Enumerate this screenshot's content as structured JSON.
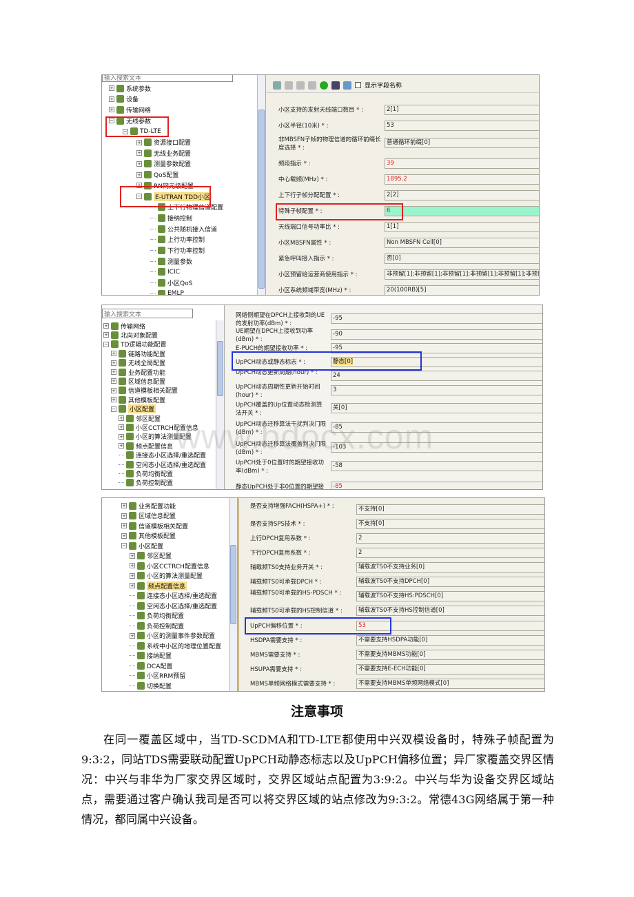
{
  "shot1": {
    "search_placeholder": "输入搜索文本",
    "show_field_name": "显示字段名称",
    "tree": [
      {
        "label": "系统参数",
        "level": 0,
        "exp": "+"
      },
      {
        "label": "设备",
        "level": 0,
        "exp": "+"
      },
      {
        "label": "传输网络",
        "level": 0,
        "exp": "+"
      },
      {
        "label": "无线参数",
        "level": 0,
        "exp": "-"
      },
      {
        "label": "TD-LTE",
        "level": 1,
        "exp": "-"
      },
      {
        "label": "资源接口配置",
        "level": 2,
        "exp": "+"
      },
      {
        "label": "无线业务配置",
        "level": 2,
        "exp": "+"
      },
      {
        "label": "测量参数配置",
        "level": 2,
        "exp": "+"
      },
      {
        "label": "QoS配置",
        "level": 2,
        "exp": "+"
      },
      {
        "label": "RN网元级配置",
        "level": 2,
        "exp": "+"
      },
      {
        "label": "E-UTRAN TDD小区",
        "level": 2,
        "exp": "-",
        "selected": true
      },
      {
        "label": "上下行物理信道配置",
        "level": 3
      },
      {
        "label": "接纳控制",
        "level": 3
      },
      {
        "label": "公共随机接入信道",
        "level": 3
      },
      {
        "label": "上行功率控制",
        "level": 3
      },
      {
        "label": "下行功率控制",
        "level": 3
      },
      {
        "label": "测量参数",
        "level": 3
      },
      {
        "label": "ICIC",
        "level": 3
      },
      {
        "label": "小区QoS",
        "level": 3
      },
      {
        "label": "EMLP",
        "level": 3
      }
    ],
    "fields": [
      {
        "label": "小区支持的发射天线端口数目 * :",
        "value": "2[1]"
      },
      {
        "label": "小区半径(10米) * :",
        "value": "53"
      },
      {
        "label": "非MBSFN子帧的物理信道的循环前缀长度选择 * :",
        "value": "普通循环前缀[0]"
      },
      {
        "label": "频段指示 * :",
        "value": "39",
        "red": true
      },
      {
        "label": "中心载频(MHz) * :",
        "value": "1895.2",
        "red": true
      },
      {
        "label": "上下行子帧分配配置 * :",
        "value": "2[2]"
      },
      {
        "label": "特殊子帧配置 * :",
        "value": "6",
        "red": true,
        "highlight": "#98f5cc"
      },
      {
        "label": "天线端口信号功率比 * :",
        "value": "1[1]"
      },
      {
        "label": "小区MBSFN属性 * :",
        "value": "Non MBSFN Cell[0]"
      },
      {
        "label": "紧急呼叫接入指示 * :",
        "value": "否[0]"
      },
      {
        "label": "小区预留给运营商使用指示 * :",
        "value": "非预留[1];非预留[1];非预留[1];非预留[1];非预留[1];非预留[1]"
      },
      {
        "label": "小区系统频域带宽(MHz) * :",
        "value": "20(100RB)[5]"
      }
    ]
  },
  "shot2": {
    "search_placeholder": "输入搜索文本",
    "tree": [
      {
        "label": "传输网络",
        "level": 0,
        "exp": "+"
      },
      {
        "label": "北向对象配置",
        "level": 0,
        "exp": "+"
      },
      {
        "label": "TD逻辑功能配置",
        "level": 0,
        "exp": "-"
      },
      {
        "label": "链路功能配置",
        "level": 1,
        "exp": "+"
      },
      {
        "label": "无线全局配置",
        "level": 1,
        "exp": "+"
      },
      {
        "label": "业务配置功能",
        "level": 1,
        "exp": "+"
      },
      {
        "label": "区域信息配置",
        "level": 1,
        "exp": "+"
      },
      {
        "label": "信道模板相关配置",
        "level": 1,
        "exp": "+"
      },
      {
        "label": "其他模板配置",
        "level": 1,
        "exp": "+"
      },
      {
        "label": "小区配置",
        "level": 1,
        "exp": "-",
        "selected": true
      },
      {
        "label": "邻区配置",
        "level": 2,
        "exp": "+"
      },
      {
        "label": "小区CCTRCH配置信息",
        "level": 2,
        "exp": "+"
      },
      {
        "label": "小区的算法测量配置",
        "level": 2,
        "exp": "+"
      },
      {
        "label": "频点配置信息",
        "level": 2,
        "exp": "+"
      },
      {
        "label": "连接态小区选择/重选配置",
        "level": 2
      },
      {
        "label": "空闲态小区选择/重选配置",
        "level": 2
      },
      {
        "label": "负荷均衡配置",
        "level": 2
      },
      {
        "label": "负荷控制配置",
        "level": 2
      }
    ],
    "fields": [
      {
        "label": "网络侧期望在DPCH上接收到的UE的发射功率(dBm) * :",
        "value": "-95"
      },
      {
        "label": "UE期望在DPCH上接收到功率(dBm) * :",
        "value": "-90"
      },
      {
        "label": "E-PUCH的期望接收功率 * :",
        "value": "-95"
      },
      {
        "label": "UpPCH动态或静态标志 * :",
        "value": "静态[0]",
        "sel": true
      },
      {
        "label": "UpPCH动态更新周期(hour) * :",
        "value": "24"
      },
      {
        "label": "UpPCH动态周期性更新开始时间(hour) * :",
        "value": "3"
      },
      {
        "label": "UpPCH覆盖的Up位置动态检测算法开关 * :",
        "value": "关[0]"
      },
      {
        "label": "UpPCH动态迁移算法干扰判决门限(dBm) * :",
        "value": "-85"
      },
      {
        "label": "UpPCH动态迁移算法覆盖判决门限(dBm) * :",
        "value": "-103"
      },
      {
        "label": "UpPCH处于0位置时的期望接收功率(dBm) * :",
        "value": "-58"
      },
      {
        "label": "静态UpPCH处于非0位置的期望接收",
        "value": "-85",
        "red": true
      }
    ]
  },
  "shot3": {
    "tree": [
      {
        "label": "业务配置功能",
        "level": 0,
        "exp": "+"
      },
      {
        "label": "区域信息配置",
        "level": 0,
        "exp": "+"
      },
      {
        "label": "信道模板相关配置",
        "level": 0,
        "exp": "+"
      },
      {
        "label": "其他模板配置",
        "level": 0,
        "exp": "+"
      },
      {
        "label": "小区配置",
        "level": 0,
        "exp": "-"
      },
      {
        "label": "邻区配置",
        "level": 1,
        "exp": "+"
      },
      {
        "label": "小区CCTRCH配置信息",
        "level": 1,
        "exp": "+"
      },
      {
        "label": "小区的算法测量配置",
        "level": 1,
        "exp": "+"
      },
      {
        "label": "频点配置信息",
        "level": 1,
        "exp": "+",
        "selected": true
      },
      {
        "label": "连接态小区选择/重选配置",
        "level": 1
      },
      {
        "label": "空闲态小区选择/重选配置",
        "level": 1
      },
      {
        "label": "负荷均衡配置",
        "level": 1
      },
      {
        "label": "负荷控制配置",
        "level": 1
      },
      {
        "label": "小区的测量事件参数配置",
        "level": 1,
        "exp": "+"
      },
      {
        "label": "系统中小区的地理位置配置",
        "level": 1
      },
      {
        "label": "接纳配置",
        "level": 1
      },
      {
        "label": "DCA配置",
        "level": 1
      },
      {
        "label": "小区RRM预留",
        "level": 1
      },
      {
        "label": "切换配置",
        "level": 1
      }
    ],
    "fields": [
      {
        "label": "是否支持增强FACH(HSPA+) * :",
        "value": "不支持[0]"
      },
      {
        "label": "是否支持SPS技术 * :",
        "value": "不支持[0]"
      },
      {
        "label": "上行DPCH复用系数 * :",
        "value": "2"
      },
      {
        "label": "下行DPCH复用系数 * :",
        "value": "2"
      },
      {
        "label": "辅载频TS0支持业务开关 * :",
        "value": "辅载波TS0不支持业务[0]"
      },
      {
        "label": "辅载频TS0可承载DPCH * :",
        "value": "辅载波TS0不支持DPCH[0]"
      },
      {
        "label": "辅载频TS0可承载的HS-PDSCH * :",
        "value": "辅载波TS0不支持HS:PDSCH[0]"
      },
      {
        "label": "辅载频TS0可承载的HS控制信道 * :",
        "value": "辅载波TS0不支持HS控制信道[0]"
      },
      {
        "label": "UpPCH偏移位置 * :",
        "value": "53",
        "red": true
      },
      {
        "label": "HSDPA需要支持 * :",
        "value": "不需要支持HSDPA功能[0]"
      },
      {
        "label": "MBMS需要支持 * :",
        "value": "不需要支持MBMS功能[0]"
      },
      {
        "label": "HSUPA需要支持 * :",
        "value": "不需要支持E-ECH功能[0]"
      },
      {
        "label": "MBMS单频网络模式需要支持 * :",
        "value": "不需要支持MBMS单频网络模式[0]"
      }
    ]
  },
  "watermark": "www.bdocx.com",
  "heading": "注意事项",
  "paragraph": "在同一覆盖区域中，当TD-SCDMA和TD-LTE都使用中兴双模设备时，特殊子帧配置为9:3:2，同站TDS需要联动配置UpPCH动静态标志以及UpPCH偏移位置；异厂家覆盖交界区情况：中兴与非华为厂家交界区域时，交界区域站点配置为3:9:2。中兴与华为设备交界区域站点，需要通过客户确认我司是否可以将交界区域的站点修改为9:3:2。常德43G网络属于第一种情况，都同属中兴设备。"
}
